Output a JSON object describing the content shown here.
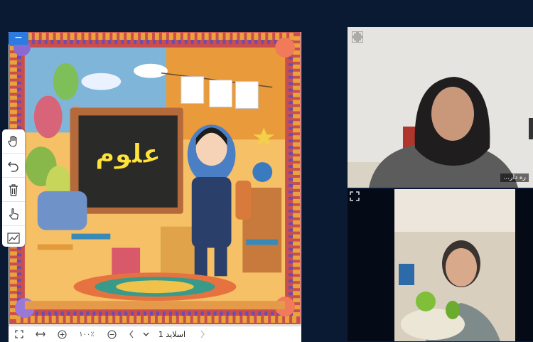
{
  "slide": {
    "title_text": "علوم",
    "collapse_label": "−"
  },
  "toolbar": {
    "zoom_level": "۱۰۰٪",
    "slide_label": "اسلاید 1",
    "fit_icon": "fit-screen-icon",
    "width_icon": "fit-width-icon",
    "zoom_in_icon": "zoom-in-icon",
    "zoom_out_icon": "zoom-out-icon",
    "prev_icon": "chevron-left-icon",
    "next_icon": "chevron-right-icon",
    "dropdown_icon": "chevron-down-icon"
  },
  "tools": [
    {
      "name": "hand-tool",
      "icon": "hand-icon"
    },
    {
      "name": "undo-tool",
      "icon": "undo-icon"
    },
    {
      "name": "delete-tool",
      "icon": "trash-icon"
    },
    {
      "name": "pointer-tool",
      "icon": "pointer-hand-icon"
    },
    {
      "name": "chart-tool",
      "icon": "chart-icon"
    }
  ],
  "videos": [
    {
      "label": "…ره دار"
    },
    {
      "label": ""
    }
  ],
  "colors": {
    "accent": "#2d7be0",
    "background": "#0b1a33"
  }
}
